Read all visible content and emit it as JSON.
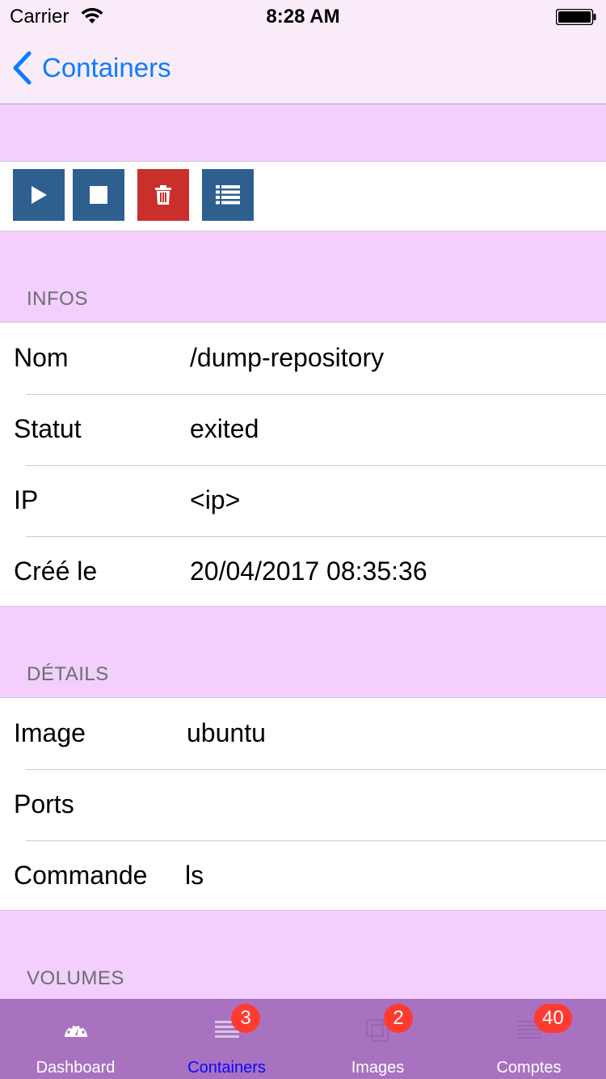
{
  "status_bar": {
    "carrier": "Carrier",
    "time": "8:28 AM"
  },
  "navbar": {
    "back_label": "Containers",
    "accent_color": "#0b7cff"
  },
  "toolbar": {
    "buttons": [
      {
        "icon": "play-icon",
        "color": "#2f5f8f"
      },
      {
        "icon": "stop-icon",
        "color": "#2f5f8f"
      },
      {
        "icon": "trash-icon",
        "color": "#c9302c"
      },
      {
        "icon": "list-icon",
        "color": "#2f5f8f"
      }
    ]
  },
  "sections": {
    "infos": {
      "title": "INFOS",
      "rows": [
        {
          "label": "Nom",
          "value": "/dump-repository"
        },
        {
          "label": "Statut",
          "value": "exited"
        },
        {
          "label": "IP",
          "value": "<ip>"
        },
        {
          "label": "Créé le",
          "value": "20/04/2017 08:35:36"
        }
      ]
    },
    "details": {
      "title": "DÉTAILS",
      "rows": [
        {
          "label": "Image",
          "value": "ubuntu"
        },
        {
          "label": "Ports",
          "value": ""
        },
        {
          "label": "Commande",
          "value": "ls"
        }
      ]
    },
    "volumes": {
      "title": "VOLUMES"
    }
  },
  "tabbar": {
    "background": "#a872c0",
    "tabs": [
      {
        "label": "Dashboard",
        "icon": "gauge-icon",
        "badge": ""
      },
      {
        "label": "Containers",
        "icon": "containers-icon",
        "badge": "3",
        "active": true
      },
      {
        "label": "Images",
        "icon": "images-icon",
        "badge": "2"
      },
      {
        "label": "Comptes",
        "icon": "accounts-icon",
        "badge": "40"
      }
    ]
  }
}
